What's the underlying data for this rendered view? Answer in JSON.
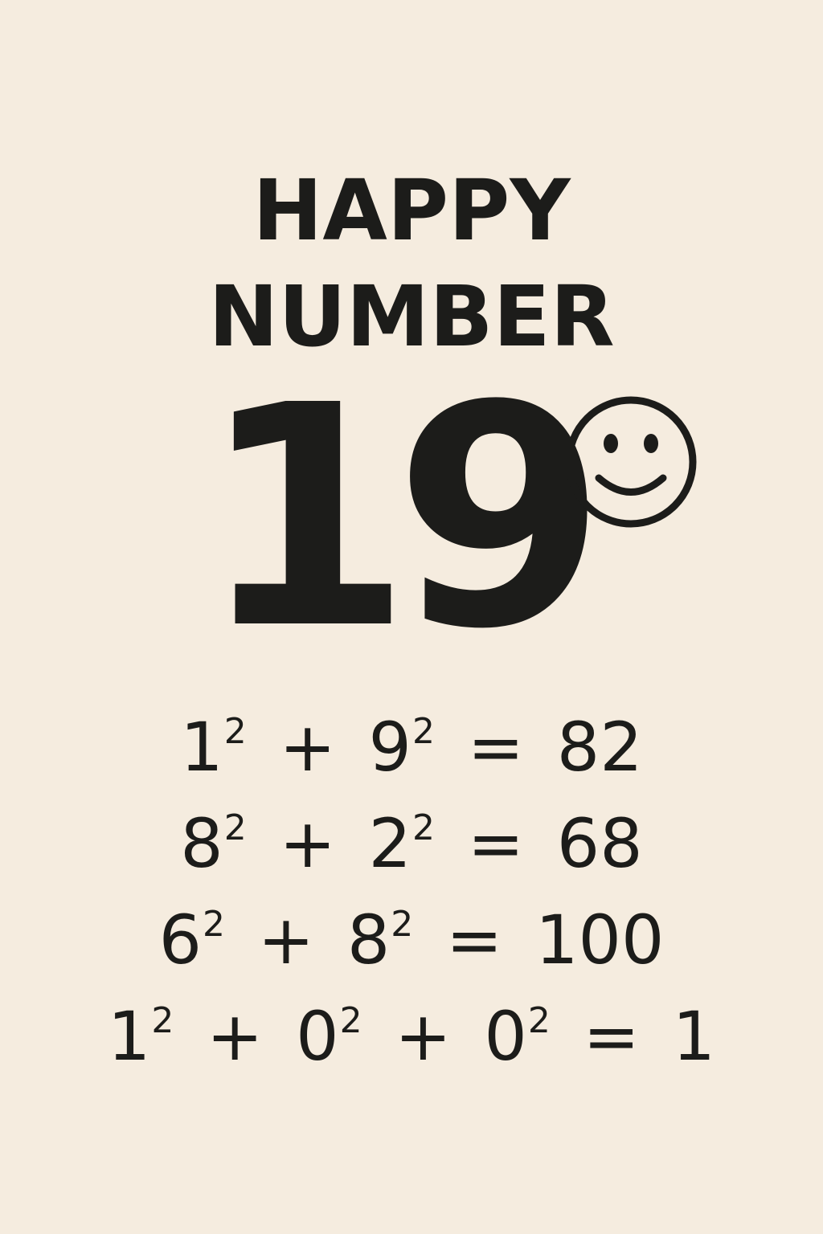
{
  "title": {
    "line1": "HAPPY",
    "line2": "NUMBER"
  },
  "number": "19",
  "icon": "smiley-face-icon",
  "equations": [
    {
      "terms": [
        {
          "base": "1",
          "exp": "2"
        },
        {
          "base": "9",
          "exp": "2"
        }
      ],
      "plus": "+",
      "equals": "=",
      "result": "82"
    },
    {
      "terms": [
        {
          "base": "8",
          "exp": "2"
        },
        {
          "base": "2",
          "exp": "2"
        }
      ],
      "plus": "+",
      "equals": "=",
      "result": "68"
    },
    {
      "terms": [
        {
          "base": "6",
          "exp": "2"
        },
        {
          "base": "8",
          "exp": "2"
        }
      ],
      "plus": "+",
      "equals": "=",
      "result": "100"
    },
    {
      "terms": [
        {
          "base": "1",
          "exp": "2"
        },
        {
          "base": "0",
          "exp": "2"
        },
        {
          "base": "0",
          "exp": "2"
        }
      ],
      "plus": "+",
      "equals": "=",
      "result": "1"
    }
  ],
  "colors": {
    "background": "#f5ecdf",
    "ink": "#1c1c1a"
  }
}
